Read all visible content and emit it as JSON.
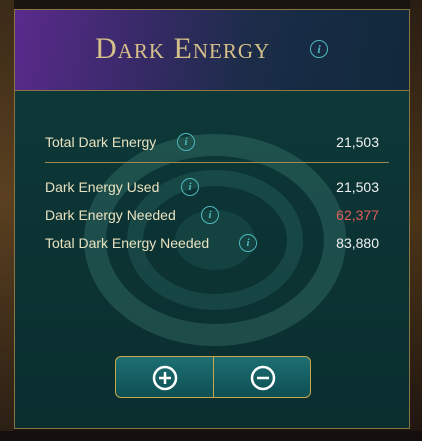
{
  "panel": {
    "title": "Dark Energy",
    "title_info_glyph": "i"
  },
  "rows": [
    {
      "label": "Total Dark Energy",
      "value": "21,503",
      "value_color": "#f2f2f2"
    },
    {
      "label": "Dark Energy Used",
      "value": "21,503",
      "value_color": "#f2f2f2"
    },
    {
      "label": "Dark Energy Needed",
      "value": "62,377",
      "value_color": "#e35b5b"
    },
    {
      "label": "Total Dark Energy Needed",
      "value": "83,880",
      "value_color": "#f2f2f2"
    }
  ],
  "info_glyph": "i",
  "buttons": {
    "increase_icon": "plus-circle-icon",
    "decrease_icon": "minus-circle-icon"
  },
  "colors": {
    "accent_teal": "#4fb8bd",
    "gold_border": "#8a7444",
    "title_gold": "#d6c089",
    "needed_red": "#e35b5b"
  }
}
